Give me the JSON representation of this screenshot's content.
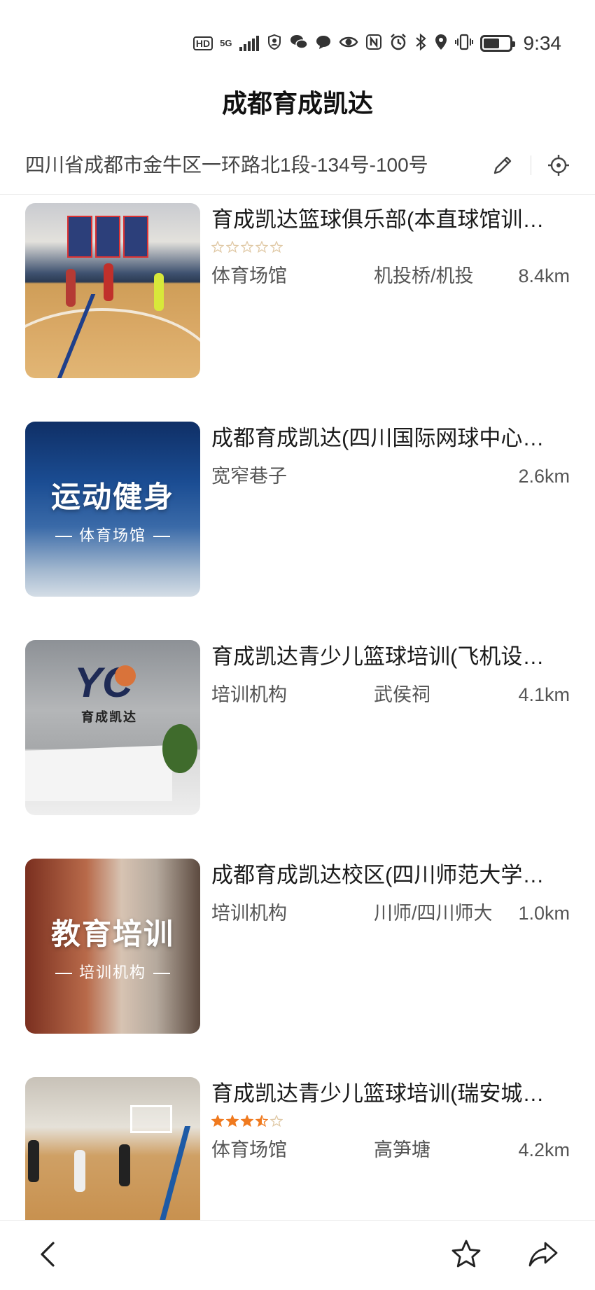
{
  "status_bar": {
    "time": "9:34",
    "icons": [
      "hd-icon",
      "5g-signal-icon",
      "profile-icon",
      "wechat-icon",
      "message-icon",
      "eye-icon",
      "nfc-icon",
      "alarm-icon",
      "bluetooth-icon",
      "location-icon",
      "vibrate-icon",
      "battery-icon"
    ],
    "hd_label": "HD",
    "network_label": "5G",
    "battery_level": 0.6
  },
  "header": {
    "title": "成都育成凯达"
  },
  "address": {
    "text": "四川省成都市金牛区一环路北1段-134号-100号",
    "edit_icon": "pencil-icon",
    "locate_icon": "crosshair-icon"
  },
  "results": [
    {
      "title": "育成凯达篮球俱乐部(本直球馆训…",
      "rating": 0,
      "rating_max": 5,
      "category": "体育场馆",
      "area": "机投桥/机投",
      "distance": "8.4km"
    },
    {
      "title": "成都育成凯达(四川国际网球中心…",
      "category": "宽窄巷子",
      "area": "",
      "distance": "2.6km",
      "thumb_big": "运动健身",
      "thumb_small": "体育场馆"
    },
    {
      "title": "育成凯达青少儿篮球培训(飞机设…",
      "category": "培训机构",
      "area": "武侯祠",
      "distance": "4.1km",
      "thumb_logo": "YC",
      "thumb_logo_text": "育成凯达"
    },
    {
      "title": "成都育成凯达校区(四川师范大学…",
      "category": "培训机构",
      "area": "川师/四川师大",
      "distance": "1.0km",
      "thumb_big": "教育培训",
      "thumb_small": "培训机构"
    },
    {
      "title": "育成凯达青少儿篮球培训(瑞安城…",
      "rating": 3.5,
      "rating_max": 5,
      "category": "体育场馆",
      "area": "高笋塘",
      "distance": "4.2km"
    }
  ],
  "colors": {
    "star_filled": "#f07a1f",
    "star_empty": "#e0c9a6",
    "text_primary": "#1a1a1a",
    "text_secondary": "#555555"
  },
  "bottom_bar": {
    "back_icon": "chevron-left-icon",
    "favorite_icon": "star-outline-icon",
    "share_icon": "share-icon"
  }
}
